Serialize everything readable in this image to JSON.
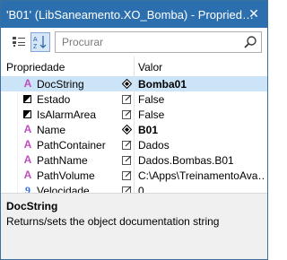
{
  "window": {
    "title": "'B01' (LibSaneamento.XO_Bomba) - Propried…",
    "close_glyph": "✕"
  },
  "toolbar": {
    "search_placeholder": "Procurar"
  },
  "grid": {
    "headers": {
      "property": "Propriedade",
      "value": "Valor"
    },
    "rows": [
      {
        "name": "DocString",
        "icon": "text-property-icon",
        "flag": "diamond",
        "value": "Bomba01",
        "bold": true,
        "selected": true
      },
      {
        "name": "Estado",
        "icon": "boolean-property-icon",
        "flag": "edit",
        "value": "False",
        "bold": false,
        "selected": false
      },
      {
        "name": "IsAlarmArea",
        "icon": "boolean-property-icon",
        "flag": "edit",
        "value": "False",
        "bold": false,
        "selected": false
      },
      {
        "name": "Name",
        "icon": "text-property-icon",
        "flag": "diamond",
        "value": "B01",
        "bold": true,
        "selected": false
      },
      {
        "name": "PathContainer",
        "icon": "text-property-icon",
        "flag": "edit",
        "value": "Dados",
        "bold": false,
        "selected": false
      },
      {
        "name": "PathName",
        "icon": "text-property-icon",
        "flag": "edit",
        "value": "Dados.Bombas.B01",
        "bold": false,
        "selected": false
      },
      {
        "name": "PathVolume",
        "icon": "text-property-icon",
        "flag": "edit",
        "value": "C:\\Apps\\TreinamentoAva…",
        "bold": false,
        "selected": false
      },
      {
        "name": "Velocidade",
        "icon": "numeric-property-icon",
        "flag": "edit",
        "value": "0",
        "bold": false,
        "selected": false
      }
    ]
  },
  "description": {
    "title": "DocString",
    "text": "Returns/sets the object documentation string"
  },
  "colors": {
    "titlebar": "#2b6fae",
    "selection": "#cce4f7",
    "text_icon": "#c04cc0",
    "numeric_icon": "#3a6fd8"
  }
}
